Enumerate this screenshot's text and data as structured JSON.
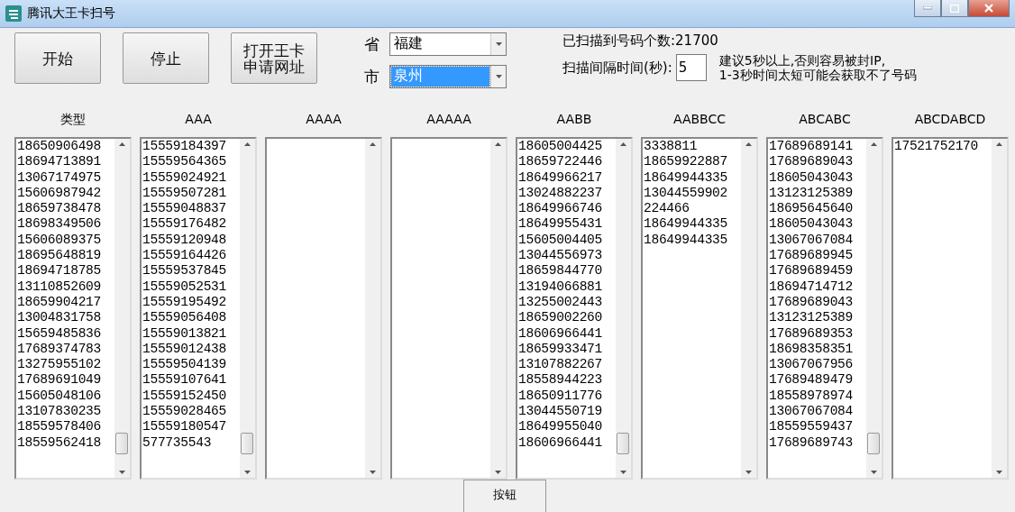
{
  "window": {
    "title": "腾讯大王卡扫号"
  },
  "buttons": [
    {
      "lines": [
        "开始"
      ]
    },
    {
      "lines": [
        "停止"
      ]
    },
    {
      "lines": [
        "打开王卡",
        "申请网址"
      ]
    }
  ],
  "selectors": [
    {
      "label": "省",
      "value": "福建",
      "selected": false
    },
    {
      "label": "市",
      "value": "泉州",
      "selected": true
    }
  ],
  "scanned": "已扫描到号码个数:21700",
  "interval": {
    "label": "扫描间隔时间(秒):",
    "value": "5"
  },
  "hint": "建议5秒以上,否则容易被封IP,\n1-3秒时间太短可能会获取不了号码",
  "columns": [
    {
      "header": "类型",
      "items": [
        "18650906498",
        "18694713891",
        "13067174975",
        "15606987942",
        "18659738478",
        "18698349506",
        "15606089375",
        "18695648819",
        "18694718785",
        "13110852609",
        "18659904217",
        "13004831758",
        "15659485836",
        "17689374783",
        "13275955102",
        "17689691049",
        "15605048106",
        "13107830235",
        "18559578406",
        "18559562418"
      ]
    },
    {
      "header": "AAA",
      "items": [
        "15559184397",
        "15559564365",
        "15559024921",
        "15559507281",
        "15559048837",
        "15559176482",
        "15559120948",
        "15559164426",
        "15559537845",
        "15559052531",
        "15559195492",
        "15559056408",
        "15559013821",
        "15559012438",
        "15559504139",
        "15559107641",
        "15559152450",
        "15559028465",
        "15559180547",
        "577735543"
      ]
    },
    {
      "header": "AAAA"
    },
    {
      "header": "AAAAA"
    },
    {
      "header": "AABB",
      "items": [
        "18605004425",
        "18659722446",
        "18649966217",
        "13024882237",
        "18649966746",
        "18649955431",
        "15605004405",
        "13044556973",
        "18659844770",
        "13194066881",
        "13255002443",
        "18659002260",
        "18606966441",
        "18659933471",
        "13107882267",
        "18558944223",
        "18650911776",
        "13044550719",
        "18649955040",
        "18606966441"
      ]
    },
    {
      "header": "AABBCC",
      "items": [
        "3338811",
        "18659922887",
        "18649944335",
        "13044559902",
        "224466",
        "18649944335",
        "18649944335"
      ]
    },
    {
      "header": "ABCABC",
      "items": [
        "17689689141",
        "17689689043",
        "18605043043",
        "13123125389",
        "18695645640",
        "18605043043",
        "13067067084",
        "17689689945",
        "17689689459",
        "18694714712",
        "17689689043",
        "13123125389",
        "17689689353",
        "18698358351",
        "13067067956",
        "17689489479",
        "18558978974",
        "13067067084",
        "18559559437",
        "17689689743"
      ]
    },
    {
      "header": "ABCDABCD",
      "items": [
        "17521752170"
      ]
    }
  ],
  "bottom_button": "按钮"
}
